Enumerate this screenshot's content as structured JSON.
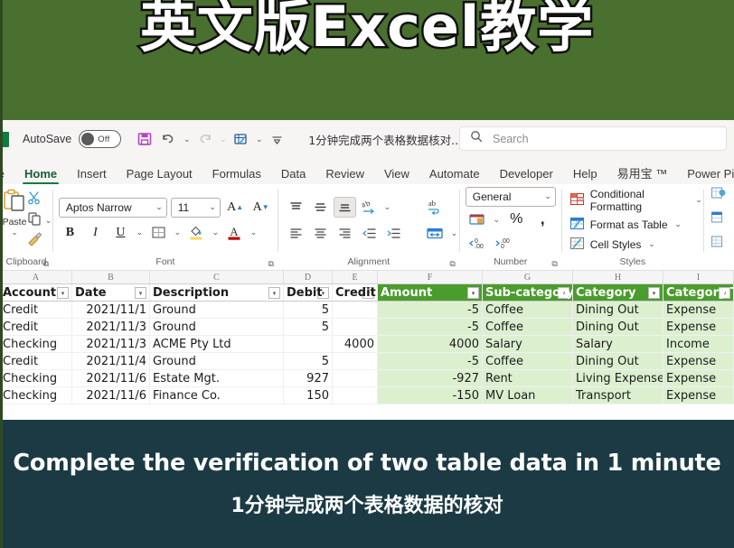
{
  "banner": {
    "title": "英文版Excel教学",
    "bg": "#4a7030"
  },
  "titlebar": {
    "autosave_label": "AutoSave",
    "autosave_state": "Off",
    "document_title": "1分钟完成两个表格数据核对...",
    "title_caret": "⌄",
    "qat": [
      {
        "name": "save-icon",
        "glyph": "🖫"
      },
      {
        "name": "undo-icon",
        "glyph": "↶"
      },
      {
        "name": "redo-icon",
        "glyph": "↷"
      },
      {
        "name": "touch-mode-icon",
        "glyph": "▦"
      },
      {
        "name": "customize-qat-icon",
        "glyph": "⩒"
      }
    ]
  },
  "search": {
    "placeholder": "Search",
    "icon": "search-icon"
  },
  "tabs": [
    {
      "label": "ile",
      "active": false
    },
    {
      "label": "Home",
      "active": true
    },
    {
      "label": "Insert",
      "active": false
    },
    {
      "label": "Page Layout",
      "active": false
    },
    {
      "label": "Formulas",
      "active": false
    },
    {
      "label": "Data",
      "active": false
    },
    {
      "label": "Review",
      "active": false
    },
    {
      "label": "View",
      "active": false
    },
    {
      "label": "Automate",
      "active": false
    },
    {
      "label": "Developer",
      "active": false
    },
    {
      "label": "Help",
      "active": false
    },
    {
      "label": "易用宝 ™",
      "active": false
    },
    {
      "label": "Power Pivot",
      "active": false
    }
  ],
  "ribbon": {
    "clipboard": {
      "label": "Clipboard",
      "paste_label": "Paste",
      "paste_caret": "⌄",
      "cut_icon": "scissors-icon",
      "copy_icon": "copy-icon",
      "format_painter_icon": "format-painter-icon",
      "copy_caret": "⌄"
    },
    "font": {
      "label": "Font",
      "font_name": "Aptos Narrow",
      "font_size": "11",
      "increase_size": "A",
      "decrease_size": "A",
      "bold": "B",
      "italic": "I",
      "underline": "U",
      "underline_caret": "⌄",
      "border_caret": "⌄",
      "fill_caret": "⌄",
      "color_caret": "⌄",
      "font_color_letter": "A",
      "fill_color": "#ffd966",
      "font_color": "#c00000"
    },
    "alignment": {
      "label": "Alignment",
      "top_align": "top-align-icon",
      "middle_align": "middle-align-icon",
      "bottom_align": "bottom-align-icon",
      "orientation": "orientation-icon",
      "align_left": "align-left-icon",
      "align_center": "align-center-icon",
      "align_right": "align-right-icon",
      "decrease_indent": "decrease-indent-icon",
      "increase_indent": "increase-indent-icon",
      "wrap_text": "wrap-text-icon",
      "merge_center": "merge-center-icon",
      "merge_caret": "⌄",
      "orientation_caret": "⌄"
    },
    "number": {
      "label": "Number",
      "format": "General",
      "format_caret": "⌄",
      "accounting": "accounting-format-icon",
      "accounting_caret": "⌄",
      "percent": "%",
      "comma": ",",
      "decrease_decimal": "decrease-decimal-icon",
      "increase_decimal": "increase-decimal-icon"
    },
    "styles": {
      "label": "Styles",
      "items": [
        {
          "label": "Conditional Formatting",
          "caret": "⌄",
          "icon": "conditional-formatting-icon"
        },
        {
          "label": "Format as Table",
          "caret": "⌄",
          "icon": "format-as-table-icon"
        },
        {
          "label": "Cell Styles",
          "caret": "⌄",
          "icon": "cell-styles-icon"
        }
      ]
    },
    "cells": {
      "items": [
        {
          "icon": "insert-cells-icon"
        },
        {
          "icon": "delete-cells-icon"
        },
        {
          "icon": "format-cells-icon"
        }
      ]
    },
    "dialog_launcher_glyph": "⧉"
  },
  "sheet": {
    "column_letters": [
      "A",
      "B",
      "C",
      "D",
      "E",
      "F",
      "G",
      "H",
      "I"
    ],
    "filter_glyph": "▾",
    "headers": [
      "Account",
      "Date",
      "Description",
      "Debit",
      "Credit",
      "Amount",
      "Sub-category",
      "Category",
      "Category Type"
    ],
    "header_green_start_index": 5,
    "green_header_color": "#4a9c2d",
    "green_body_color": "#dcf0d0",
    "rows": [
      {
        "account": "Credit",
        "date": "2021/11/1",
        "description": "Ground",
        "debit": "5",
        "credit": "",
        "amount": "-5",
        "subcategory": "Coffee",
        "category": "Dining Out",
        "type": "Expense"
      },
      {
        "account": "Credit",
        "date": "2021/11/3",
        "description": "Ground",
        "debit": "5",
        "credit": "",
        "amount": "-5",
        "subcategory": "Coffee",
        "category": "Dining Out",
        "type": "Expense"
      },
      {
        "account": "Checking",
        "date": "2021/11/3",
        "description": "ACME Pty Ltd",
        "debit": "",
        "credit": "4000",
        "amount": "4000",
        "subcategory": "Salary",
        "category": "Salary",
        "type": "Income"
      },
      {
        "account": "Credit",
        "date": "2021/11/4",
        "description": "Ground",
        "debit": "5",
        "credit": "",
        "amount": "-5",
        "subcategory": "Coffee",
        "category": "Dining Out",
        "type": "Expense"
      },
      {
        "account": "Checking",
        "date": "2021/11/6",
        "description": "Estate Mgt.",
        "debit": "927",
        "credit": "",
        "amount": "-927",
        "subcategory": "Rent",
        "category": "Living Expenses",
        "type": "Expense"
      },
      {
        "account": "Checking",
        "date": "2021/11/6",
        "description": "Finance Co.",
        "debit": "150",
        "credit": "",
        "amount": "-150",
        "subcategory": "MV Loan",
        "category": "Transport",
        "type": "Expense"
      }
    ]
  },
  "caption": {
    "english": "Complete the verification of two table data in 1 minute",
    "chinese": "1分钟完成两个表格数据的核对",
    "bg": "#1b3a44"
  }
}
